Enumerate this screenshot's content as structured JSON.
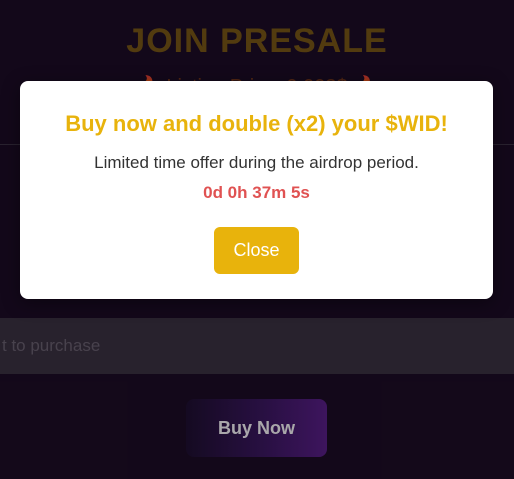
{
  "background": {
    "title": "JOIN PRESALE",
    "subtitle": "🔥 Listing Price: 0.003$ 🔥",
    "input_placeholder": "t to purchase",
    "buy_button_label": "Buy Now"
  },
  "modal": {
    "title": "Buy now and double (x2) your $WID!",
    "text": "Limited time offer during the airdrop period.",
    "countdown": "0d 0h 37m 5s",
    "close_label": "Close"
  },
  "colors": {
    "accent": "#e8b30c",
    "countdown": "#e05252",
    "background": "#1a0c22"
  }
}
